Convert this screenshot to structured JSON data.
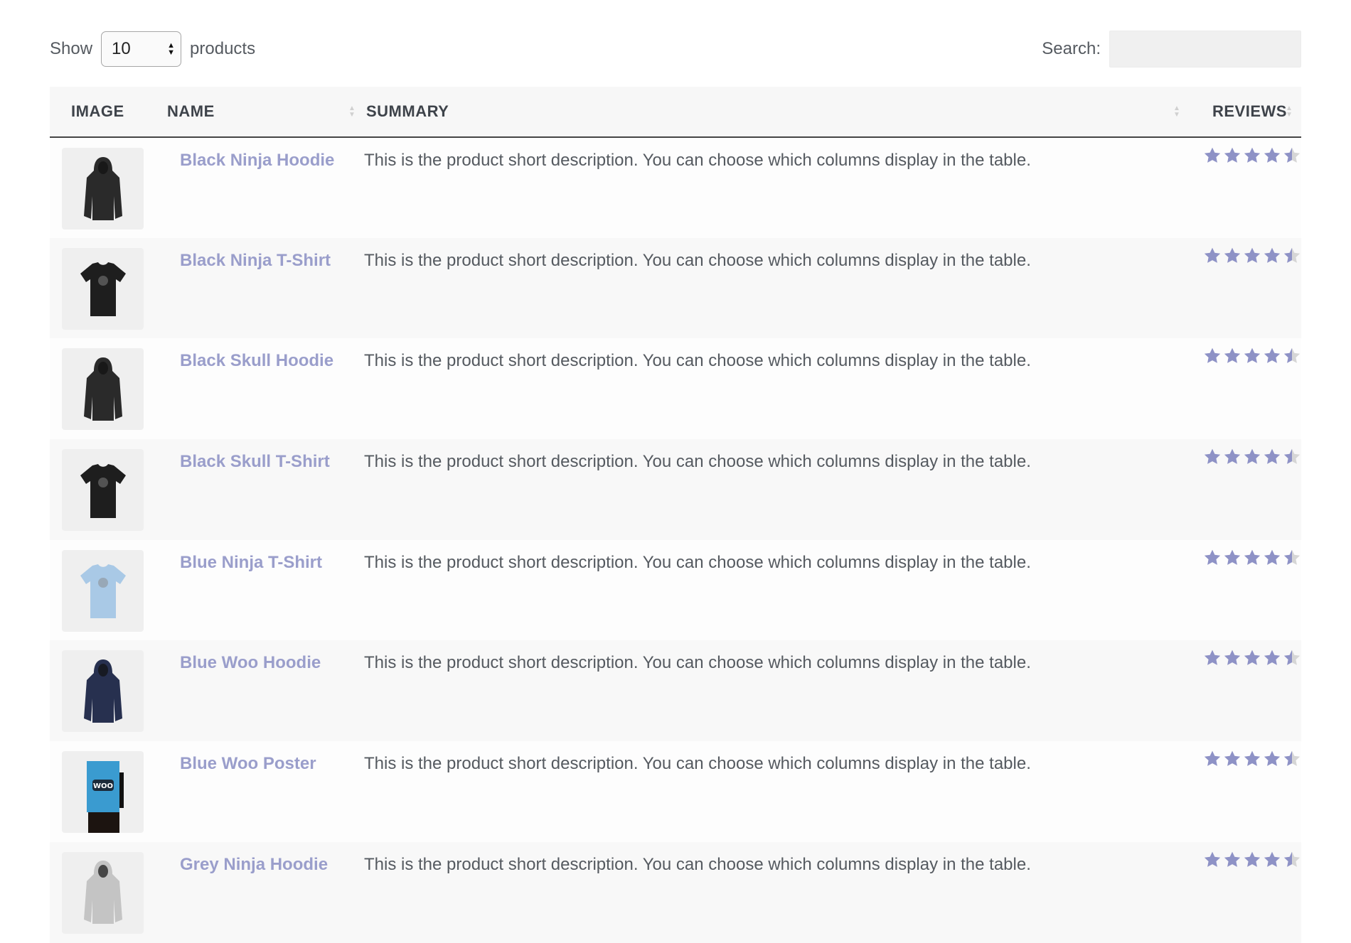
{
  "controls": {
    "show_label": "Show",
    "page_length_value": "10",
    "products_label": "products",
    "search_label": "Search:",
    "search_value": "",
    "search_placeholder": ""
  },
  "table": {
    "columns": [
      {
        "key": "image",
        "label": "IMAGE",
        "sortable": false
      },
      {
        "key": "name",
        "label": "NAME",
        "sortable": true
      },
      {
        "key": "summary",
        "label": "SUMMARY",
        "sortable": true
      },
      {
        "key": "reviews",
        "label": "REVIEWS",
        "sortable": true
      }
    ],
    "rows": [
      {
        "name": "Black Ninja Hoodie",
        "summary": "This is the product short description. You can choose which columns display in the table.",
        "rating": 4.5,
        "max_rating": 5,
        "image": "hoodie",
        "color": "#2a2a2a"
      },
      {
        "name": "Black Ninja T-Shirt",
        "summary": "This is the product short description. You can choose which columns display in the table.",
        "rating": 4.5,
        "max_rating": 5,
        "image": "tshirt",
        "color": "#1e1e1e"
      },
      {
        "name": "Black Skull Hoodie",
        "summary": "This is the product short description. You can choose which columns display in the table.",
        "rating": 4.5,
        "max_rating": 5,
        "image": "hoodie",
        "color": "#2a2a2a"
      },
      {
        "name": "Black Skull T-Shirt",
        "summary": "This is the product short description. You can choose which columns display in the table.",
        "rating": 4.5,
        "max_rating": 5,
        "image": "tshirt",
        "color": "#1e1e1e"
      },
      {
        "name": "Blue Ninja T-Shirt",
        "summary": "This is the product short description. You can choose which columns display in the table.",
        "rating": 4.5,
        "max_rating": 5,
        "image": "tshirt",
        "color": "#a9c9e6"
      },
      {
        "name": "Blue Woo Hoodie",
        "summary": "This is the product short description. You can choose which columns display in the table.",
        "rating": 4.5,
        "max_rating": 5,
        "image": "hoodie",
        "color": "#27304f"
      },
      {
        "name": "Blue Woo Poster",
        "summary": "This is the product short description. You can choose which columns display in the table.",
        "rating": 4.5,
        "max_rating": 5,
        "image": "poster",
        "color": "#3a9bd0"
      },
      {
        "name": "Grey Ninja Hoodie",
        "summary": "This is the product short description. You can choose which columns display in the table.",
        "rating": 4.5,
        "max_rating": 5,
        "image": "hoodie",
        "color": "#c4c4c4"
      }
    ]
  },
  "colors": {
    "link": "#9a9ecb",
    "star_filled": "#8e92c6",
    "star_empty": "#d6d6d6"
  }
}
